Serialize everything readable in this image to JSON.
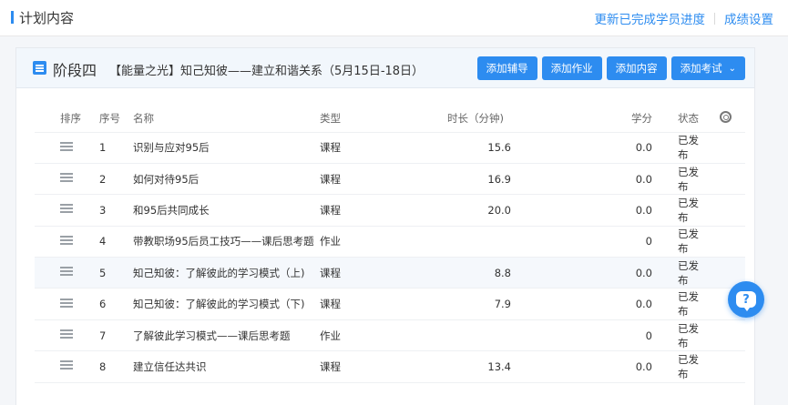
{
  "header": {
    "title": "计划内容",
    "update_progress_link": "更新已完成学员进度",
    "score_settings_link": "成绩设置"
  },
  "stage": {
    "name": "阶段四",
    "title": "【能量之光】知己知彼——建立和谐关系（5月15日-18日）",
    "buttons": {
      "add_tutoring": "添加辅导",
      "add_homework": "添加作业",
      "add_content": "添加内容",
      "add_exam": "添加考试"
    }
  },
  "table": {
    "headers": {
      "sort": "排序",
      "index": "序号",
      "name": "名称",
      "type": "类型",
      "duration": "时长（分钟)",
      "credit": "学分",
      "status": "状态"
    },
    "rows": [
      {
        "index": "1",
        "name": "识别与应对95后",
        "type": "课程",
        "duration": "15.6",
        "credit": "0.0",
        "status": "已发布"
      },
      {
        "index": "2",
        "name": "如何对待95后",
        "type": "课程",
        "duration": "16.9",
        "credit": "0.0",
        "status": "已发布"
      },
      {
        "index": "3",
        "name": "和95后共同成长",
        "type": "课程",
        "duration": "20.0",
        "credit": "0.0",
        "status": "已发布"
      },
      {
        "index": "4",
        "name": "带教职场95后员工技巧——课后思考题",
        "type": "作业",
        "duration": "",
        "credit": "0",
        "status": "已发布"
      },
      {
        "index": "5",
        "name": "知己知彼：了解彼此的学习模式（上)",
        "type": "课程",
        "duration": "8.8",
        "credit": "0.0",
        "status": "已发布"
      },
      {
        "index": "6",
        "name": "知己知彼：了解彼此的学习模式（下)",
        "type": "课程",
        "duration": "7.9",
        "credit": "0.0",
        "status": "已发布"
      },
      {
        "index": "7",
        "name": "了解彼此学习模式——课后思考题",
        "type": "作业",
        "duration": "",
        "credit": "0",
        "status": "已发布"
      },
      {
        "index": "8",
        "name": "建立信任达共识",
        "type": "课程",
        "duration": "13.4",
        "credit": "0.0",
        "status": "已发布"
      }
    ]
  },
  "icons": {
    "document": "document-icon",
    "drag": "drag-handle-icon",
    "settings": "gear-icon",
    "help": "help-icon",
    "dropdown": "chevron-down-icon"
  },
  "colors": {
    "accent": "#2d8cf0"
  }
}
